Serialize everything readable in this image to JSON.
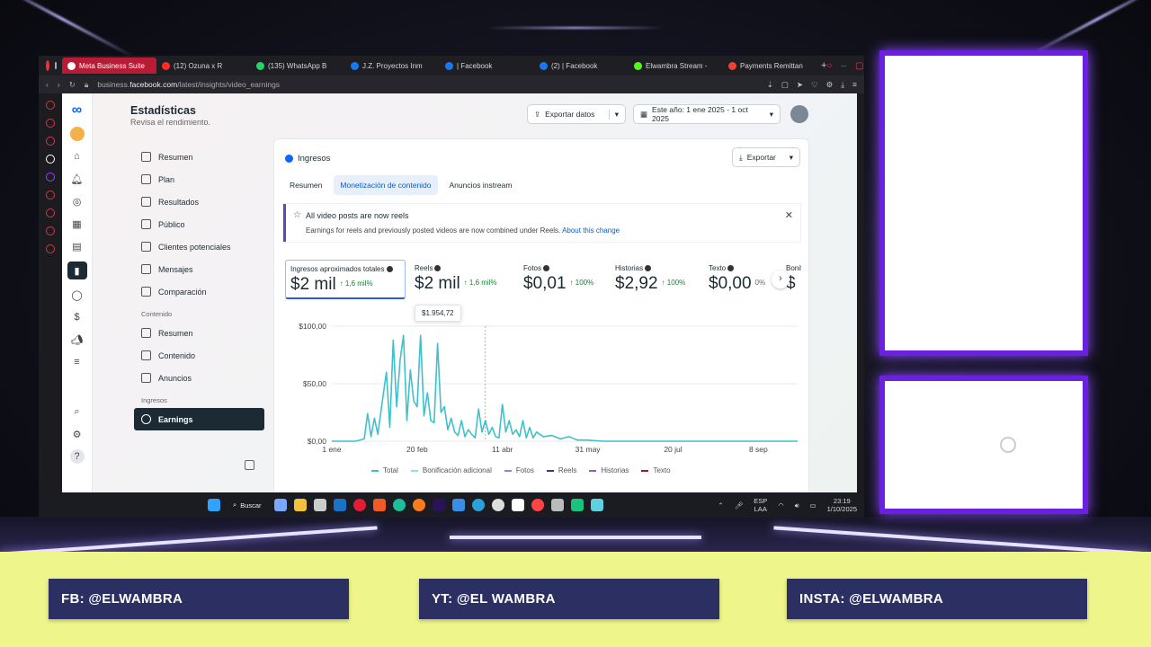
{
  "browser": {
    "tabs": [
      {
        "label": "Meta Business Suite",
        "active": true,
        "color": "#ffffff"
      },
      {
        "label": "(12) Ozuna x R",
        "active": false,
        "color": "#ff2a2a"
      },
      {
        "label": "(135) WhatsApp B",
        "active": false,
        "color": "#25d366"
      },
      {
        "label": "J.Z. Proyectos Inm",
        "active": false,
        "color": "#1877f2"
      },
      {
        "label": "| Facebook",
        "active": false,
        "color": "#1877f2"
      },
      {
        "label": "(2) | Facebook",
        "active": false,
        "color": "#1877f2"
      },
      {
        "label": "Elwambra Stream -",
        "active": false,
        "color": "#53fc18"
      },
      {
        "label": "Payments Remittan",
        "active": false,
        "color": "#ea4335"
      }
    ],
    "url_prefix": "business.",
    "url_domain": "facebook.com",
    "url_path": "/latest/insights/video_earnings"
  },
  "page": {
    "title": "Estadísticas",
    "subtitle": "Revisa el rendimiento.",
    "export_data_label": "Exportar datos",
    "date_range_label": "Este año: 1 ene 2025 - 1 oct 2025"
  },
  "sidenav": {
    "items": [
      "Resumen",
      "Plan",
      "Resultados",
      "Público",
      "Clientes potenciales",
      "Mensajes",
      "Comparación"
    ],
    "section_content": "Contenido",
    "content_items": [
      "Resumen",
      "Contenido",
      "Anuncios"
    ],
    "section_income": "Ingresos",
    "active_item": "Earnings"
  },
  "card": {
    "title": "Ingresos",
    "export_label": "Exportar",
    "tabs": [
      "Resumen",
      "Monetización de contenido",
      "Anuncios instream"
    ],
    "active_tab": 1,
    "notice": {
      "title": "All video posts are now reels",
      "body": "Earnings for reels and previously posted videos are now combined under Reels.",
      "link": "About this change"
    },
    "metrics": [
      {
        "label": "Ingresos aproximados totales",
        "value": "$2 mil",
        "change": "↑ 1,6 mil%",
        "selected": true
      },
      {
        "label": "Reels",
        "value": "$2 mil",
        "change": "↑ 1,6 mil%",
        "selected": false
      },
      {
        "label": "Fotos",
        "value": "$0,01",
        "change": "↑ 100%",
        "selected": false
      },
      {
        "label": "Historias",
        "value": "$2,92",
        "change": "↑ 100%",
        "selected": false
      },
      {
        "label": "Texto",
        "value": "$0,00",
        "change": "0%",
        "selected": false
      },
      {
        "label": "Bonifi",
        "value": "$",
        "change": "",
        "selected": false
      }
    ],
    "tooltip": "$1.954,72",
    "legend": [
      {
        "name": "Total",
        "color": "#3fc1c9"
      },
      {
        "name": "Bonificación adicional",
        "color": "#8fe0e6"
      },
      {
        "name": "Fotos",
        "color": "#7b8cde"
      },
      {
        "name": "Reels",
        "color": "#4b2a91"
      },
      {
        "name": "Historias",
        "color": "#9a5bc2"
      },
      {
        "name": "Texto",
        "color": "#a3153b"
      }
    ]
  },
  "chart_data": {
    "type": "line",
    "y_tick_labels": [
      "$100,00",
      "$50,00",
      "$0,00"
    ],
    "ylim": [
      0,
      100
    ],
    "x_tick_labels": [
      "1 ene",
      "20 feb",
      "11 abr",
      "31 may",
      "20 jul",
      "8 sep"
    ],
    "x_ticks_day": [
      1,
      51,
      101,
      151,
      201,
      251
    ],
    "series": [
      {
        "name": "Total",
        "color": "#3fc1c9",
        "x_day": [
          1,
          10,
          15,
          20,
          22,
          24,
          26,
          28,
          30,
          33,
          35,
          37,
          39,
          41,
          43,
          45,
          47,
          49,
          51,
          53,
          55,
          57,
          59,
          61,
          63,
          65,
          67,
          69,
          71,
          73,
          75,
          77,
          79,
          81,
          83,
          85,
          87,
          89,
          91,
          93,
          95,
          97,
          99,
          101,
          103,
          105,
          107,
          109,
          111,
          113,
          115,
          117,
          119,
          121,
          125,
          130,
          135,
          140,
          145,
          150,
          160,
          180,
          200,
          220,
          240,
          260,
          274
        ],
        "y": [
          0,
          0,
          0,
          2,
          24,
          4,
          20,
          6,
          28,
          60,
          12,
          88,
          30,
          70,
          92,
          18,
          62,
          35,
          30,
          92,
          22,
          42,
          18,
          16,
          85,
          25,
          30,
          10,
          20,
          8,
          5,
          18,
          4,
          10,
          6,
          3,
          28,
          8,
          18,
          6,
          12,
          4,
          3,
          32,
          8,
          18,
          6,
          10,
          4,
          18,
          3,
          12,
          3,
          8,
          4,
          5,
          2,
          4,
          1,
          1,
          0,
          0,
          0,
          0,
          0,
          0,
          0
        ]
      }
    ]
  },
  "taskbar": {
    "search_label": "Buscar",
    "lang": "ESP",
    "lang2": "LAA",
    "time": "23:19",
    "date": "1/10/2025"
  },
  "social": {
    "fb": "FB: @ELWAMBRA",
    "yt": "YT: @EL WAMBRA",
    "insta": "INSTA: @ELWAMBRA"
  }
}
